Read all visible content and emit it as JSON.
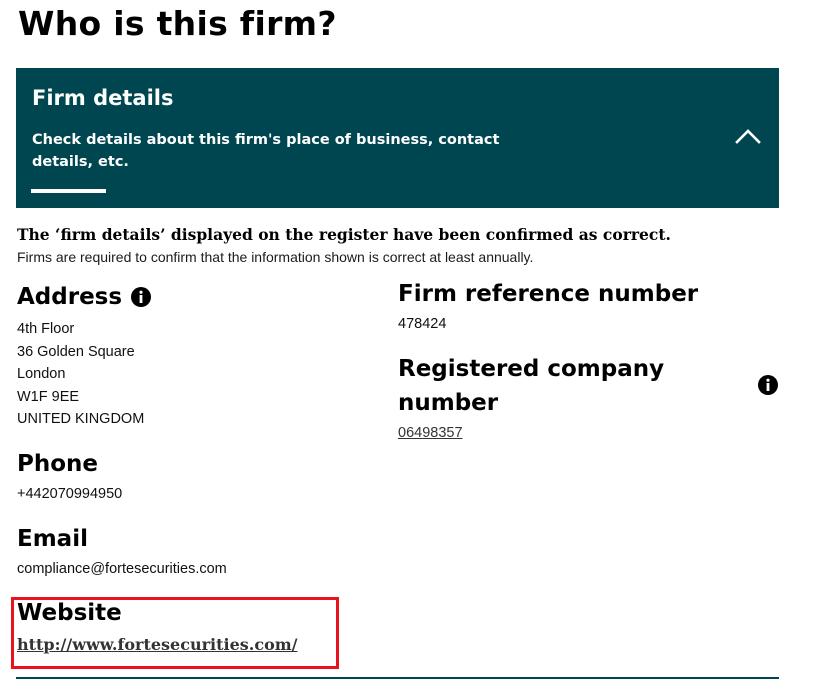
{
  "page": {
    "title": "Who is this firm?"
  },
  "firm_details_panel": {
    "title": "Firm details",
    "description": "Check details about this firm's place of business, contact details, etc.",
    "expanded": true,
    "background_color": "#004650",
    "toggle_icon": "chevron-up-icon"
  },
  "confirmation": {
    "headline": "The ‘firm details’ displayed on the register have been confirmed as correct.",
    "subtext": "Firms are required to confirm that the information shown is correct at least annually."
  },
  "address": {
    "label": "Address",
    "info_icon": "info-icon",
    "lines": [
      "4th Floor",
      "36 Golden Square",
      "London",
      "W1F 9EE",
      "UNITED KINGDOM"
    ]
  },
  "phone": {
    "label": "Phone",
    "value": "+442070994950"
  },
  "email": {
    "label": "Email",
    "value": "compliance@fortesecurities.com"
  },
  "website": {
    "label": "Website",
    "value": "http://www.fortesecurities.com/",
    "highlight_color": "#e8141c"
  },
  "firm_reference": {
    "label": "Firm reference number",
    "value": "478424"
  },
  "registered_company": {
    "label_line1": "Registered company",
    "label_line2": "number",
    "info_icon": "info-icon",
    "value": "06498357"
  }
}
